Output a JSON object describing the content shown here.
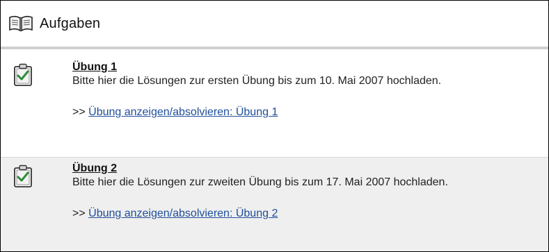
{
  "header": {
    "title": "Aufgaben",
    "icon": "open-book-icon"
  },
  "tasks": [
    {
      "title": "Übung 1",
      "description": "Bitte hier die Lösungen zur ersten Übung bis zum 10. Mai 2007 hochladen.",
      "link_prefix": ">>",
      "link_label": "Übung anzeigen/absolvieren: Übung 1",
      "icon": "clipboard-check-icon"
    },
    {
      "title": "Übung 2",
      "description": "Bitte hier die Lösungen zur zweiten Übung bis zum 17. Mai 2007 hochladen.",
      "link_prefix": ">>",
      "link_label": "Übung anzeigen/absolvieren: Übung 2",
      "icon": "clipboard-check-icon"
    }
  ],
  "colors": {
    "link": "#1f4e9a",
    "alt_row": "#efefef",
    "check": "#2e8b3a"
  }
}
